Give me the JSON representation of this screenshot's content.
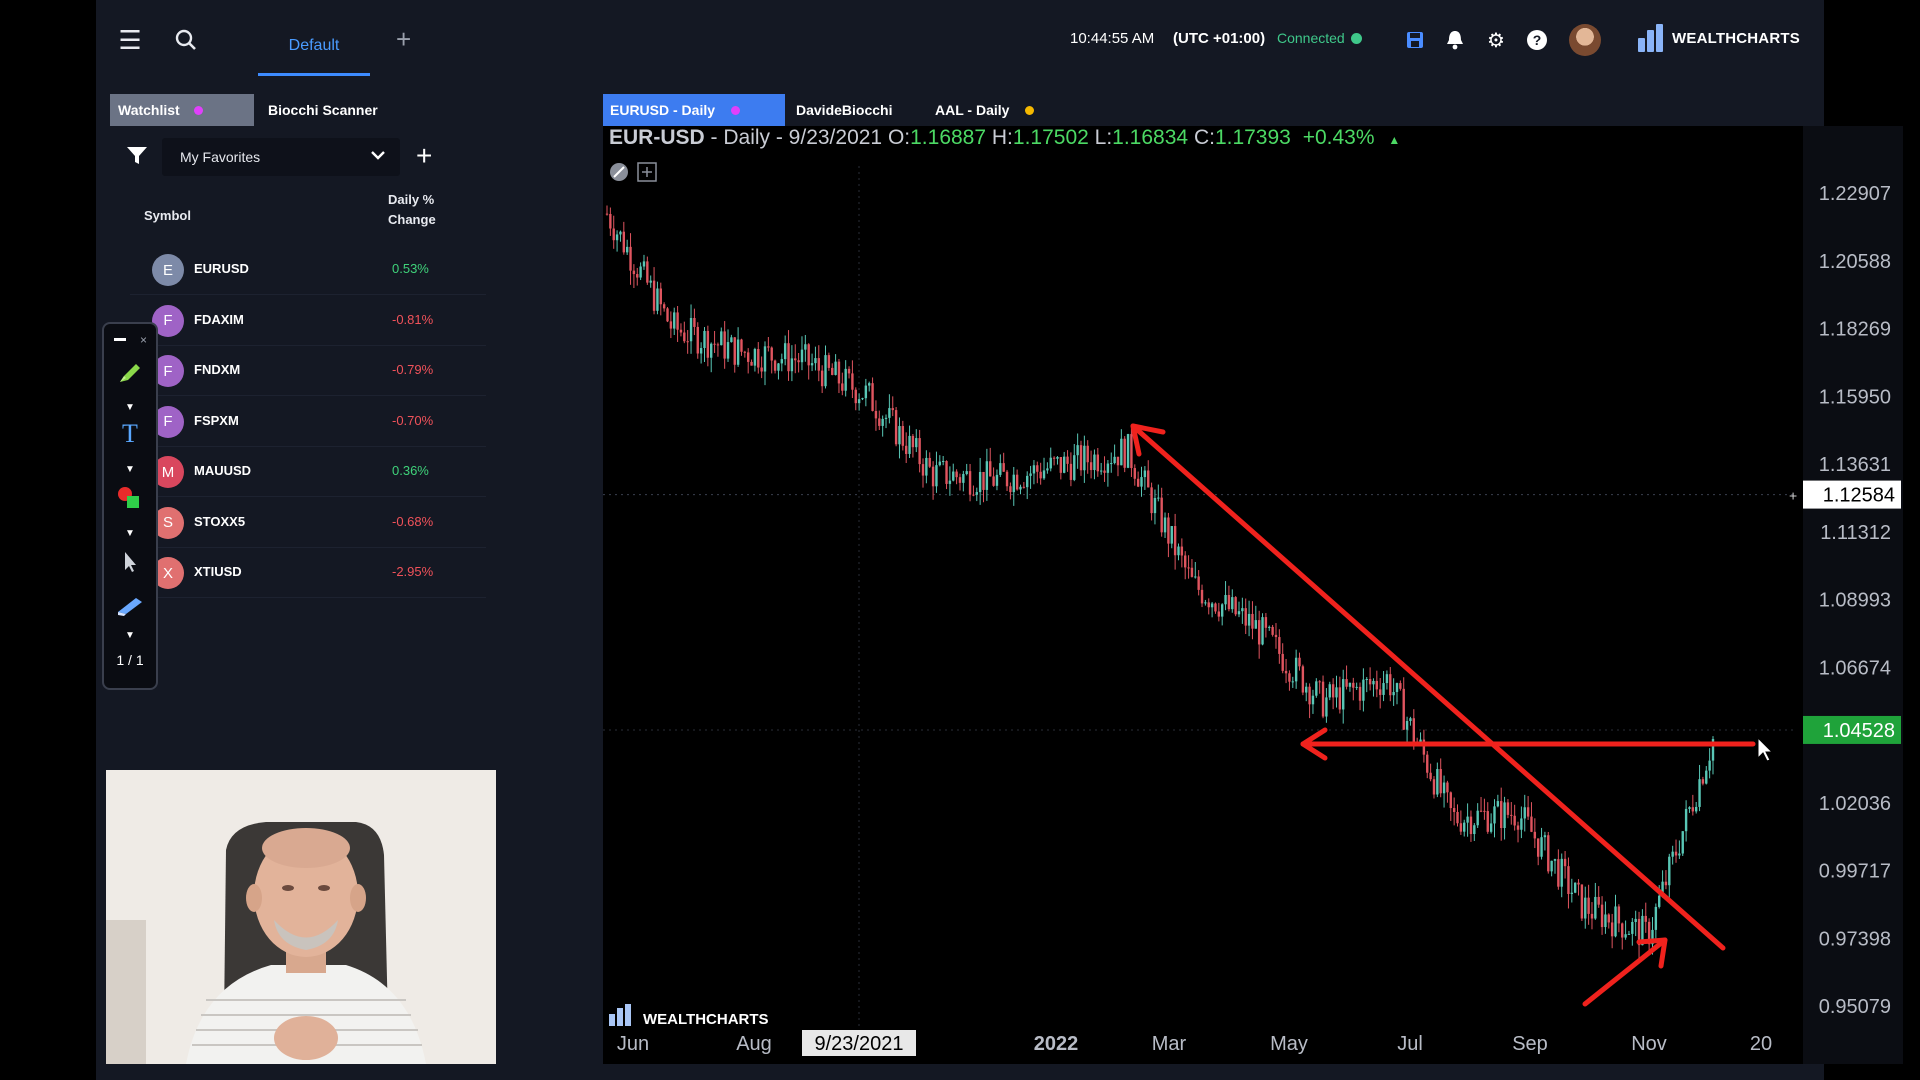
{
  "topbar": {
    "menu_icon": "hamburger-icon",
    "search_icon": "search-icon",
    "layout_tab": "Default",
    "add_tab_icon": "plus-icon",
    "time": "10:44:55 AM",
    "timezone": "(UTC +01:00)",
    "connection_status": "Connected",
    "brand": "WEALTHCHARTS"
  },
  "watchlist": {
    "tabs": [
      "Watchlist",
      "Biocchi Scanner"
    ],
    "active_tab": "Watchlist",
    "list_name": "My Favorites",
    "col_symbol": "Symbol",
    "col_change": "Daily % Change",
    "rows": [
      {
        "initial": "E",
        "symbol": "EURUSD",
        "change": "0.53%",
        "dir": "up",
        "color": "#7d8aa8"
      },
      {
        "initial": "F",
        "symbol": "FDAXIM",
        "change": "-0.81%",
        "dir": "down",
        "color": "#9f63c6"
      },
      {
        "initial": "F",
        "symbol": "FNDXM",
        "change": "-0.79%",
        "dir": "down",
        "color": "#9f63c6"
      },
      {
        "initial": "F",
        "symbol": "FSPXM",
        "change": "-0.70%",
        "dir": "down",
        "color": "#9f63c6"
      },
      {
        "initial": "M",
        "symbol": "MAUUSD",
        "change": "0.36%",
        "dir": "up",
        "color": "#d9475e"
      },
      {
        "initial": "S",
        "symbol": "STOXX5",
        "change": "-0.68%",
        "dir": "down",
        "color": "#e07070"
      },
      {
        "initial": "X",
        "symbol": "XTIUSD",
        "change": "-2.95%",
        "dir": "down",
        "color": "#e07070"
      }
    ]
  },
  "drawing_toolbar": {
    "page_indicator": "1 / 1"
  },
  "chart_tabs": [
    {
      "label": "EURUSD - Daily",
      "active": true,
      "dot": "#e040fb"
    },
    {
      "label": "DavideBiocchi",
      "active": false,
      "dot": ""
    },
    {
      "label": "AAL - Daily",
      "active": false,
      "dot": "#f5b800"
    }
  ],
  "chart_header": {
    "symbol": "EUR-USD",
    "interval": "- Daily - 9/23/2021",
    "o_label": "O:",
    "o": "1.16887",
    "h_label": "H:",
    "h": "1.17502",
    "l_label": "L:",
    "l": "1.16834",
    "c_label": "C:",
    "c": "1.17393",
    "change": "+0.43%"
  },
  "chart_data": {
    "type": "candlestick",
    "title": "EUR-USD - Daily",
    "x_tick_labels": [
      "Jun",
      "Aug",
      "9/23/2021",
      "2022",
      "Mar",
      "May",
      "Jul",
      "Sep",
      "Nov",
      "20"
    ],
    "y_tick_labels": [
      "1.22907",
      "1.20588",
      "1.18269",
      "1.15950",
      "1.13631",
      "1.11312",
      "1.08993",
      "1.06674",
      "1.02036",
      "0.99717",
      "0.97398",
      "0.95079"
    ],
    "ylim": [
      0.943,
      1.245
    ],
    "crosshair_price": "1.12584",
    "last_price": "1.04528",
    "cursor_date": "9/23/2021",
    "watermark": "WEALTHCHARTS",
    "close_path_approx": [
      [
        "Jun",
        1.222
      ],
      [
        "Jul",
        1.183
      ],
      [
        "Aug",
        1.175
      ],
      [
        "Sep",
        1.172
      ],
      [
        "Oct",
        1.16
      ],
      [
        "Nov",
        1.133
      ],
      [
        "Dec",
        1.131
      ],
      [
        "2022",
        1.136
      ],
      [
        "Feb",
        1.141
      ],
      [
        "Mar",
        1.095
      ],
      [
        "Apr",
        1.08
      ],
      [
        "May",
        1.055
      ],
      [
        "Jun",
        1.063
      ],
      [
        "Jul",
        1.015
      ],
      [
        "Aug",
        1.017
      ],
      [
        "Sep",
        0.985
      ],
      [
        "Oct",
        0.975
      ],
      [
        "Nov",
        1.042
      ]
    ],
    "annotations": [
      "red downward trendline arrow from Feb-2022 high to Nov-2022",
      "red horizontal arrow at ~1.045",
      "red upward arrow at Oct-2022 low"
    ]
  }
}
